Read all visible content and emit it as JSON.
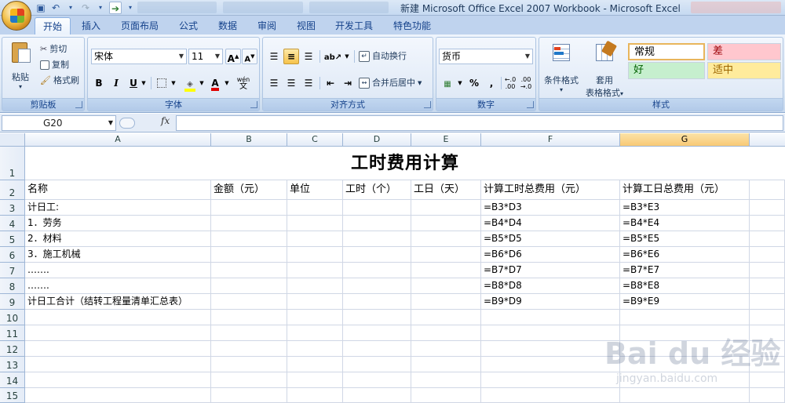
{
  "window": {
    "title": "新建 Microsoft Office Excel 2007 Workbook - Microsoft Excel"
  },
  "quick_access": [
    "save-icon",
    "undo-icon",
    "redo-icon",
    "forward-icon"
  ],
  "tabs": [
    {
      "label": "开始",
      "active": true
    },
    {
      "label": "插入"
    },
    {
      "label": "页面布局"
    },
    {
      "label": "公式"
    },
    {
      "label": "数据"
    },
    {
      "label": "审阅"
    },
    {
      "label": "视图"
    },
    {
      "label": "开发工具"
    },
    {
      "label": "特色功能"
    }
  ],
  "ribbon": {
    "clipboard": {
      "paste": "粘贴",
      "cut": "剪切",
      "copy": "复制",
      "format_painter": "格式刷",
      "label": "剪贴板"
    },
    "font": {
      "name": "宋体",
      "size": "11",
      "label": "字体",
      "bold": "B",
      "italic": "I",
      "underline": "U",
      "grow": "A",
      "shrink": "A",
      "phonetic": "wén"
    },
    "alignment": {
      "wrap": "自动换行",
      "merge": "合并后居中",
      "label": "对齐方式"
    },
    "number": {
      "format": "货币",
      "percent": "%",
      "comma": ",",
      "label": "数字"
    },
    "styles": {
      "conditional": "条件格式",
      "table_line1": "套用",
      "table_line2": "表格格式",
      "normal": "常规",
      "bad": "差",
      "good": "好",
      "neutral": "适中",
      "label": "样式"
    }
  },
  "formula_bar": {
    "name_box": "G20",
    "fx": "fx",
    "formula": ""
  },
  "columns": [
    "A",
    "B",
    "C",
    "D",
    "E",
    "F",
    "G"
  ],
  "selected_column": "G",
  "rows": [
    "1",
    "2",
    "3",
    "4",
    "5",
    "6",
    "7",
    "8",
    "9",
    "10",
    "11",
    "12",
    "13",
    "14",
    "15"
  ],
  "sheet": {
    "title": "工时费用计算",
    "headers": [
      "名称",
      "金额（元）",
      "单位",
      "工时（个）",
      "工日（天）",
      "计算工时总费用（元）",
      "计算工日总费用（元）"
    ],
    "data_rows": [
      {
        "a": "计日工:",
        "f": "=B3*D3",
        "g": "=B3*E3"
      },
      {
        "a": "1．劳务",
        "f": "=B4*D4",
        "g": "=B4*E4"
      },
      {
        "a": "2．材料",
        "f": "=B5*D5",
        "g": "=B5*E5"
      },
      {
        "a": "3．施工机械",
        "f": "=B6*D6",
        "g": "=B6*E6"
      },
      {
        "a": "…….",
        "f": "=B7*D7",
        "g": "=B7*E7"
      },
      {
        "a": "…….",
        "f": "=B8*D8",
        "g": "=B8*E8"
      },
      {
        "a": "计日工合计（结转工程量清单汇总表）",
        "f": "=B9*D9",
        "g": "=B9*E9"
      }
    ]
  },
  "watermark": {
    "brand": "Bai du 经验",
    "url": "jingyan.baidu.com"
  },
  "colors": {
    "accent": "#15428b",
    "selected_header": "#f8c975",
    "style_bad": "#ffc7ce",
    "style_good": "#c6efce",
    "style_neutral": "#ffeb9c"
  }
}
